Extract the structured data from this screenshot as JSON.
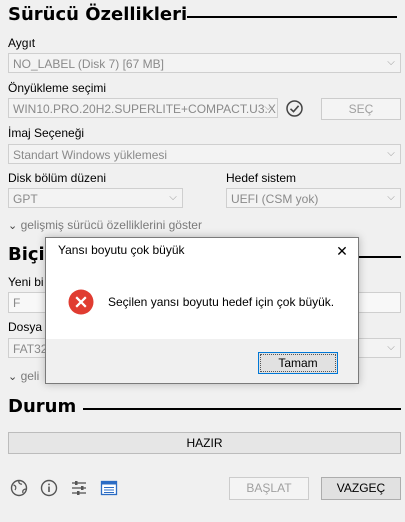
{
  "drive_props": {
    "title": "Sürücü Özellikleri",
    "device_label": "Aygıt",
    "device_value": "NO_LABEL (Disk 7) [67 MB]",
    "boot_label": "Önyükleme seçimi",
    "boot_value": "WIN10.PRO.20H2.SUPERLITE+COMPACT.U3.X",
    "select_button": "SEÇ",
    "image_option_label": "İmaj Seçeneği",
    "image_option_value": "Standart Windows yüklemesi",
    "partition_label": "Disk bölüm düzeni",
    "partition_value": "GPT",
    "target_label": "Hedef sistem",
    "target_value": "UEFI (CSM yok)",
    "advanced_toggle": "gelişmiş sürücü özelliklerini göster"
  },
  "format_opts": {
    "title_partial": "Biçi",
    "volume_label_partial": "Yeni bi",
    "volume_value": "F",
    "fs_label_partial": "Dosya s",
    "fs_value": "FAT32",
    "advanced_toggle_partial": "geli"
  },
  "status": {
    "title": "Durum",
    "bar_text": "HAZIR"
  },
  "footer": {
    "start_button": "BAŞLAT",
    "cancel_button": "VAZGEÇ"
  },
  "dialog": {
    "title": "Yansı boyutu çok büyük",
    "message": "Seçilen yansı boyutu hedef için çok büyük.",
    "ok_button": "Tamam",
    "close_glyph": "✕"
  },
  "colors": {
    "error_red": "#e03c31",
    "ok_border": "#0078d7"
  }
}
